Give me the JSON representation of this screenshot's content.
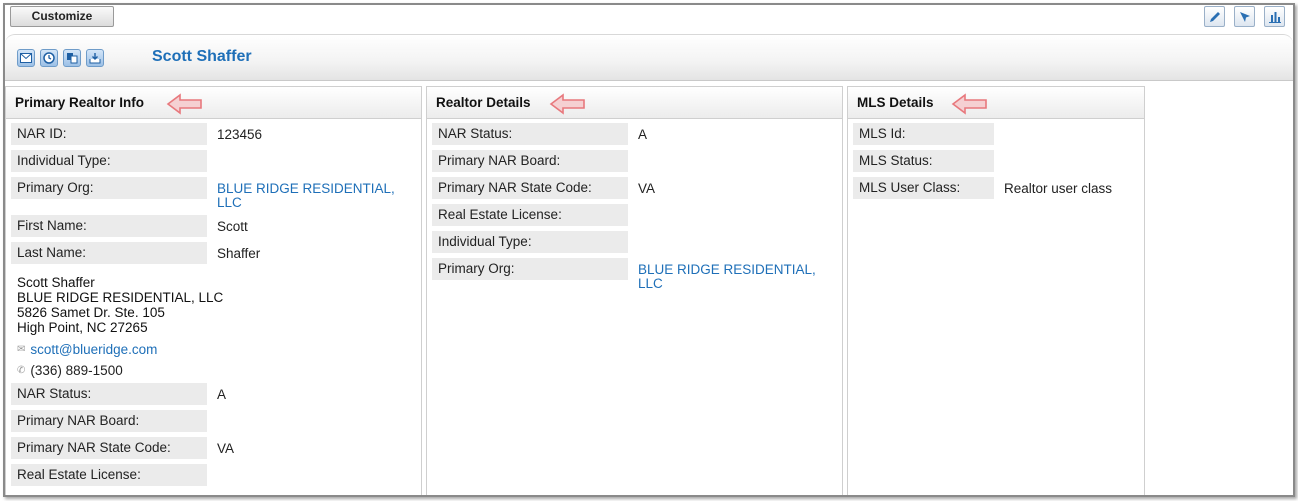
{
  "toolbar": {
    "customize_label": "Customize"
  },
  "header": {
    "contact_name": "Scott Shaffer"
  },
  "panels": {
    "primary": {
      "title": "Primary Realtor Info",
      "top_rows": [
        {
          "label": "NAR ID:",
          "value": "123456"
        },
        {
          "label": "Individual Type:",
          "value": ""
        },
        {
          "label": "Primary Org:",
          "value": "BLUE RIDGE RESIDENTIAL, LLC"
        },
        {
          "label": "First Name:",
          "value": "Scott"
        },
        {
          "label": "Last Name:",
          "value": "Shaffer"
        }
      ],
      "address": [
        "Scott Shaffer",
        "BLUE RIDGE RESIDENTIAL, LLC",
        "5826 Samet Dr. Ste. 105",
        "High Point, NC 27265"
      ],
      "email": "scott@blueridge.com",
      "phone": "(336) 889-1500",
      "bottom_rows": [
        {
          "label": "NAR Status:",
          "value": "A"
        },
        {
          "label": "Primary NAR Board:",
          "value": ""
        },
        {
          "label": "Primary NAR State Code:",
          "value": "VA"
        },
        {
          "label": "Real Estate License:",
          "value": ""
        }
      ]
    },
    "realtor": {
      "title": "Realtor Details",
      "rows": [
        {
          "label": "NAR Status:",
          "value": "A"
        },
        {
          "label": "Primary NAR Board:",
          "value": ""
        },
        {
          "label": "Primary NAR State Code:",
          "value": "VA"
        },
        {
          "label": "Real Estate License:",
          "value": ""
        },
        {
          "label": "Individual Type:",
          "value": ""
        },
        {
          "label": "Primary Org:",
          "value": "BLUE RIDGE RESIDENTIAL, LLC"
        }
      ]
    },
    "mls": {
      "title": "MLS Details",
      "rows": [
        {
          "label": "MLS Id:",
          "value": ""
        },
        {
          "label": "MLS Status:",
          "value": ""
        },
        {
          "label": "MLS User Class:",
          "value": "Realtor user class"
        }
      ]
    }
  },
  "icons": {
    "top": [
      "pencil-icon",
      "cursor-icon",
      "bar-chart-icon"
    ],
    "header": [
      "email-icon",
      "clock-icon",
      "copy-icon",
      "inbox-download-icon"
    ]
  },
  "colors": {
    "link": "#1e6fb8",
    "callout": "#e8787d",
    "label_bg": "#ebebeb"
  }
}
